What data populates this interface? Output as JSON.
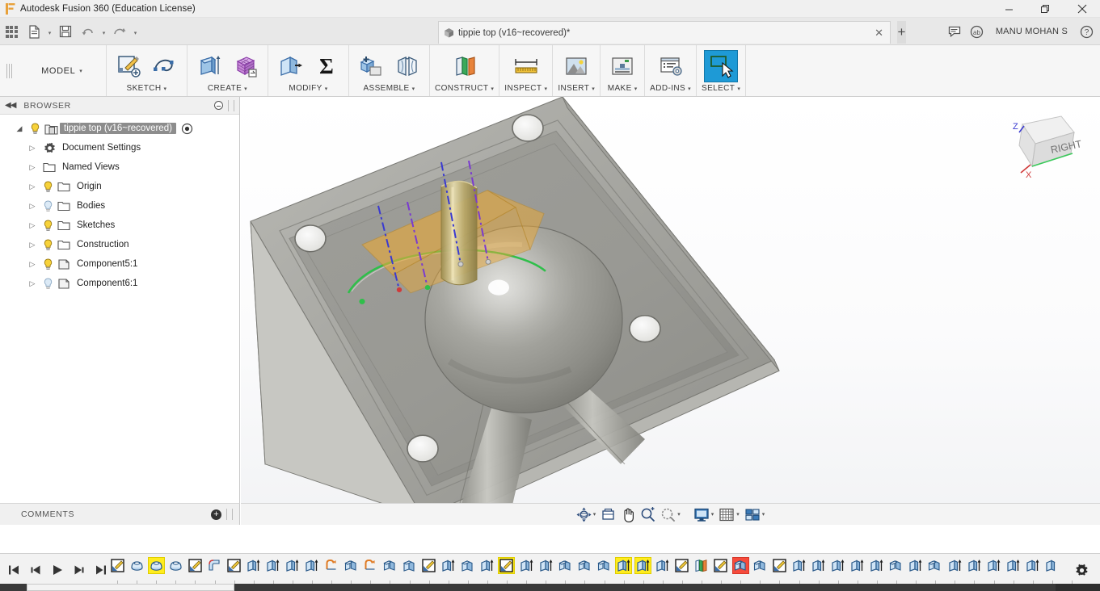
{
  "window": {
    "title": "Autodesk Fusion 360 (Education License)",
    "app_icon": "fusion-logo-icon",
    "minimize": "–",
    "maximize": "❐",
    "close": "✕"
  },
  "quick_access": {
    "grid_icon": "app-grid-icon",
    "file_icon": "file-icon",
    "file_caret": "▾",
    "save_icon": "save-icon",
    "undo_icon": "undo-arrow-icon",
    "undo_caret": "▾",
    "redo_icon": "redo-arrow-icon",
    "redo_caret": "▾",
    "document_tab": {
      "label": "tippie top (v16~recovered)*",
      "cube_icon": "document-cube-icon",
      "close": "✕"
    },
    "new_tab": "+",
    "comments_icon": "comment-bubble-icon",
    "job_status_icon": "job-status-icon",
    "user_name": "MANU MOHAN S",
    "help_icon": "help-question-icon"
  },
  "ribbon": {
    "workspace": {
      "label": "MODEL",
      "caret": "▾"
    },
    "groups": [
      {
        "name": "SKETCH",
        "caret": "▾",
        "icons": [
          "create-sketch-icon",
          "spline-icon"
        ]
      },
      {
        "name": "CREATE",
        "caret": "▾",
        "icons": [
          "extrude-icon",
          "create-form-icon"
        ]
      },
      {
        "name": "MODIFY",
        "caret": "▾",
        "icons": [
          "press-pull-icon",
          "combine-sigma-icon"
        ]
      },
      {
        "name": "ASSEMBLE",
        "caret": "▾",
        "icons": [
          "new-component-icon",
          "joint-icon"
        ]
      },
      {
        "name": "CONSTRUCT",
        "caret": "▾",
        "icons": [
          "offset-plane-icon"
        ]
      },
      {
        "name": "INSPECT",
        "caret": "▾",
        "icons": [
          "measure-icon"
        ]
      },
      {
        "name": "INSERT",
        "caret": "▾",
        "icons": [
          "insert-image-icon"
        ]
      },
      {
        "name": "MAKE",
        "caret": "▾",
        "icons": [
          "3d-print-icon"
        ]
      },
      {
        "name": "ADD-INS",
        "caret": "▾",
        "icons": [
          "addins-scripts-icon"
        ]
      },
      {
        "name": "SELECT",
        "caret": "▾",
        "icons": [
          "select-window-icon"
        ],
        "active": true
      }
    ]
  },
  "browser": {
    "header": {
      "collapse_icon": "collapse-left-icon",
      "title": "BROWSER",
      "options_icon": "browser-options-icon"
    },
    "root": {
      "label": "tippie top (v16~recovered)",
      "triangle": "◢",
      "bulb": "on",
      "component_icon": "assembly-component-icon",
      "eye_icon": "display-settings-icon",
      "selected": true
    },
    "items": [
      {
        "label": "Document Settings",
        "triangle": "▷",
        "bulb": "none",
        "icon": "gear-icon"
      },
      {
        "label": "Named Views",
        "triangle": "▷",
        "bulb": "none",
        "icon": "folder-icon"
      },
      {
        "label": "Origin",
        "triangle": "▷",
        "bulb": "on",
        "icon": "folder-icon"
      },
      {
        "label": "Bodies",
        "triangle": "▷",
        "bulb": "off",
        "icon": "folder-icon"
      },
      {
        "label": "Sketches",
        "triangle": "▷",
        "bulb": "on",
        "icon": "folder-icon"
      },
      {
        "label": "Construction",
        "triangle": "▷",
        "bulb": "on",
        "icon": "folder-icon"
      },
      {
        "label": "Component5:1",
        "triangle": "▷",
        "bulb": "on",
        "icon": "component-icon"
      },
      {
        "label": "Component6:1",
        "triangle": "▷",
        "bulb": "off",
        "icon": "component-icon"
      }
    ]
  },
  "comments_bar": {
    "title": "COMMENTS",
    "add_icon": "add-comment-icon"
  },
  "navbar": {
    "items": [
      {
        "name": "orbit-icon",
        "caret": "▾"
      },
      {
        "name": "look-at-icon",
        "caret": ""
      },
      {
        "name": "pan-hand-icon",
        "caret": ""
      },
      {
        "name": "zoom-in-icon",
        "caret": ""
      },
      {
        "name": "zoom-window-icon",
        "caret": "▾"
      },
      {
        "name": "display-settings-icon",
        "caret": "▾"
      },
      {
        "name": "grid-snaps-icon",
        "caret": "▾"
      },
      {
        "name": "viewports-icon",
        "caret": "▾"
      }
    ]
  },
  "viewcube": {
    "face_label": "RIGHT",
    "axis_z": "Z",
    "axis_x": "X"
  },
  "timeline": {
    "playback": [
      {
        "name": "skip-to-beginning-button",
        "glyph": "⏮"
      },
      {
        "name": "step-back-button",
        "glyph": "⏪"
      },
      {
        "name": "play-button",
        "glyph": "▶"
      },
      {
        "name": "step-forward-button",
        "glyph": "⏩"
      },
      {
        "name": "skip-to-end-button",
        "glyph": "⏭"
      }
    ],
    "settings_icon": "timeline-settings-gear-icon",
    "features": [
      {
        "type": "sketch",
        "highlight": "none"
      },
      {
        "type": "revolve",
        "highlight": "none"
      },
      {
        "type": "revolve",
        "highlight": "yellow"
      },
      {
        "type": "revolve",
        "highlight": "none"
      },
      {
        "type": "sketch",
        "highlight": "none"
      },
      {
        "type": "fillet",
        "highlight": "none"
      },
      {
        "type": "sketch",
        "highlight": "none"
      },
      {
        "type": "extrude",
        "highlight": "none"
      },
      {
        "type": "extrude",
        "highlight": "none"
      },
      {
        "type": "extrude",
        "highlight": "none"
      },
      {
        "type": "extrude",
        "highlight": "none"
      },
      {
        "type": "shell",
        "highlight": "none"
      },
      {
        "type": "mirror",
        "highlight": "none"
      },
      {
        "type": "shell",
        "highlight": "none"
      },
      {
        "type": "mirror",
        "highlight": "none"
      },
      {
        "type": "move",
        "highlight": "none"
      },
      {
        "type": "sketch",
        "highlight": "none"
      },
      {
        "type": "extrude",
        "highlight": "none"
      },
      {
        "type": "move",
        "highlight": "none"
      },
      {
        "type": "extrude",
        "highlight": "none"
      },
      {
        "type": "sketch",
        "highlight": "yellow"
      },
      {
        "type": "extrude",
        "highlight": "none"
      },
      {
        "type": "extrude",
        "highlight": "none"
      },
      {
        "type": "mirror",
        "highlight": "none"
      },
      {
        "type": "mirror",
        "highlight": "none"
      },
      {
        "type": "mirror",
        "highlight": "none"
      },
      {
        "type": "extrude",
        "highlight": "yellow"
      },
      {
        "type": "extrude",
        "highlight": "yellow"
      },
      {
        "type": "extrude",
        "highlight": "none"
      },
      {
        "type": "sketch",
        "highlight": "none"
      },
      {
        "type": "plane",
        "highlight": "none"
      },
      {
        "type": "sketch",
        "highlight": "none"
      },
      {
        "type": "mirror",
        "highlight": "red"
      },
      {
        "type": "mirror",
        "highlight": "none"
      },
      {
        "type": "sketch",
        "highlight": "none"
      },
      {
        "type": "extrude",
        "highlight": "none"
      },
      {
        "type": "extrude",
        "highlight": "none"
      },
      {
        "type": "extrude",
        "highlight": "none"
      },
      {
        "type": "extrude",
        "highlight": "none"
      },
      {
        "type": "extrude",
        "highlight": "none"
      },
      {
        "type": "mirror",
        "highlight": "none"
      },
      {
        "type": "extrude",
        "highlight": "none"
      },
      {
        "type": "mirror",
        "highlight": "none"
      },
      {
        "type": "extrude",
        "highlight": "none"
      },
      {
        "type": "extrude",
        "highlight": "none"
      },
      {
        "type": "extrude",
        "highlight": "none"
      },
      {
        "type": "extrude",
        "highlight": "none"
      },
      {
        "type": "extrude",
        "highlight": "none"
      },
      {
        "type": "extrude",
        "highlight": "none"
      },
      {
        "type": "extrude",
        "highlight": "none"
      }
    ]
  },
  "colors": {
    "accent_blue": "#1e9ad6",
    "highlight_yellow": "#ffec1f",
    "highlight_red": "#f64b3c",
    "sketch_plane_orange": "#e8a83a",
    "construction_axis_blue": "#3a3ad0",
    "selected_edge_green": "#2fbf4a",
    "titlebar_bg": "#f0f0f0",
    "ribbon_bg": "#f6f6f6",
    "model_metal": "#9a9a96"
  }
}
